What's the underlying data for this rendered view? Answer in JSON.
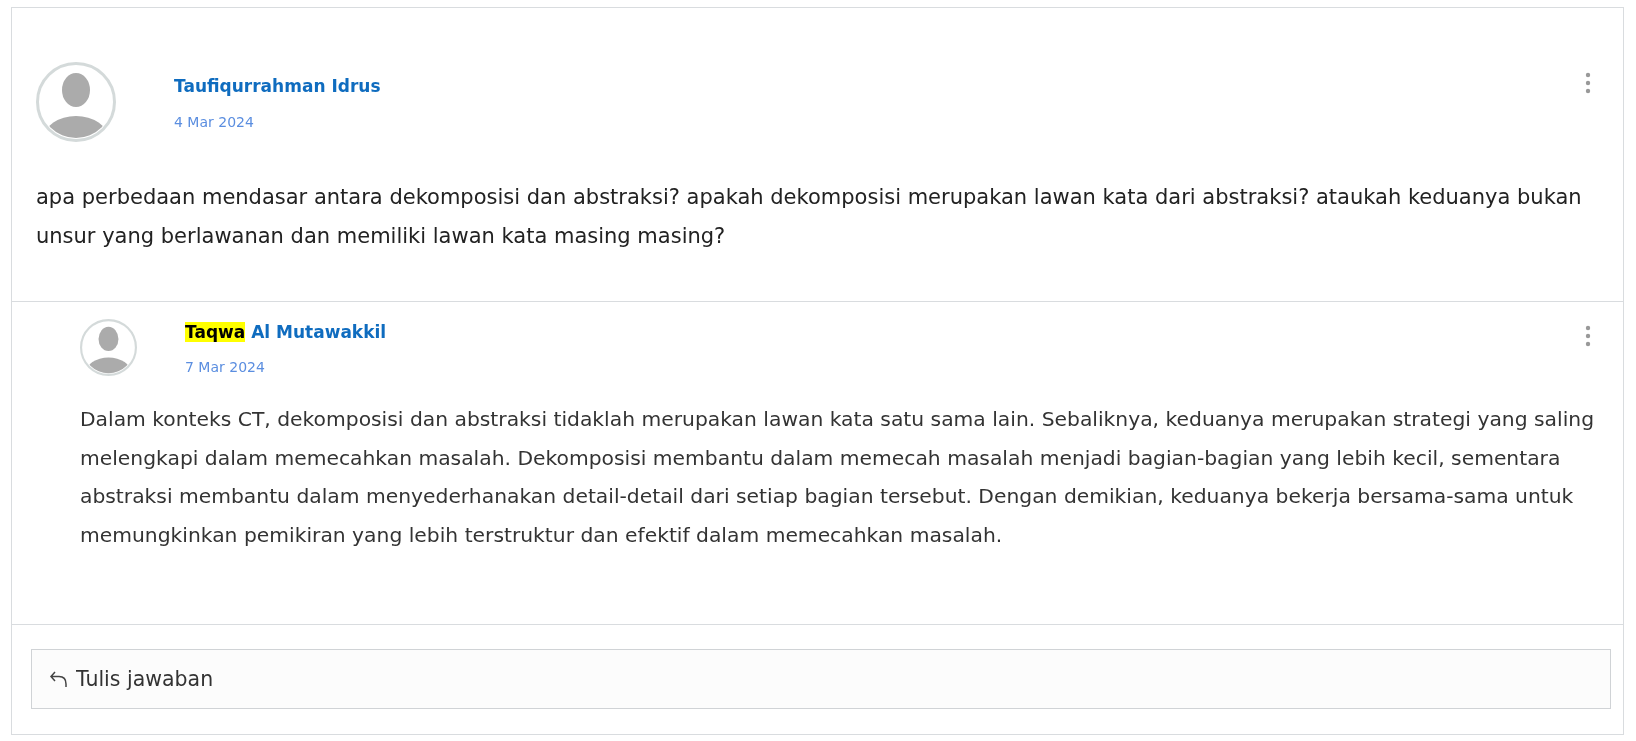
{
  "post": {
    "author": [
      {
        "text": "Taufiqurrahman Idrus",
        "highlighted": false
      }
    ],
    "date": "4 Mar 2024",
    "body": "apa perbedaan mendasar antara dekomposisi dan abstraksi? apakah dekomposisi merupakan lawan kata dari abstraksi? ataukah keduanya bukan unsur yang berlawanan dan memiliki lawan kata masing masing?"
  },
  "replies": [
    {
      "author": [
        {
          "text": "Taqwa",
          "highlighted": true
        },
        {
          "text": " Al Mutawakkil",
          "highlighted": false
        }
      ],
      "date": "7 Mar 2024",
      "body": "Dalam konteks CT, dekomposisi dan abstraksi tidaklah merupakan lawan kata satu sama lain. Sebaliknya, keduanya merupakan strategi yang saling melengkapi dalam memecahkan masalah. Dekomposisi membantu dalam memecah masalah menjadi bagian-bagian yang lebih kecil, sementara abstraksi membantu dalam menyederhanakan detail-detail dari setiap bagian tersebut. Dengan demikian, keduanya bekerja bersama-sama untuk memungkinkan pemikiran yang lebih terstruktur dan efektif dalam memecahkan masalah."
    }
  ],
  "reply_field": {
    "placeholder": "Tulis jawaban"
  }
}
